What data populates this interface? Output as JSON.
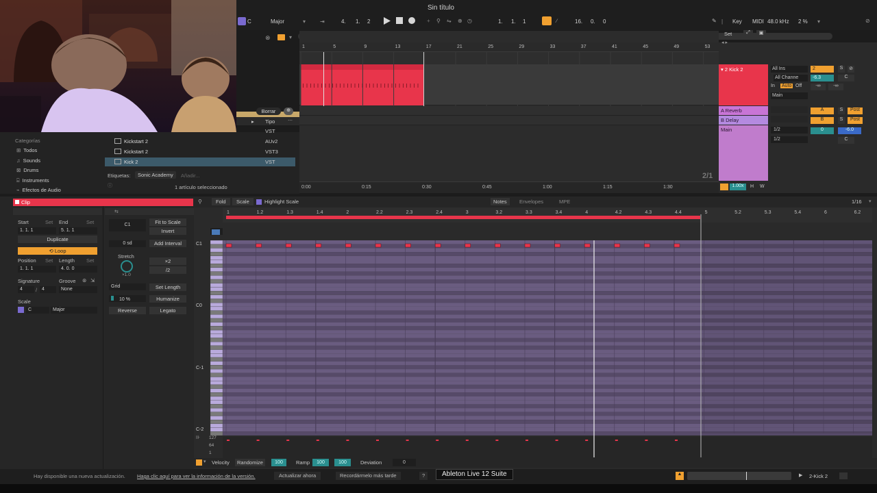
{
  "top": {
    "title": "Sin título",
    "key": "C",
    "scale": "Major",
    "position": [
      "4.",
      "1.",
      "2"
    ],
    "loop_start": [
      "1.",
      "1.",
      "1"
    ],
    "loop_len": [
      "16.",
      "0.",
      "0"
    ],
    "key_btn": "Key",
    "midi_btn": "MIDI",
    "sample_rate": "48.0 kHz",
    "cpu": "2 %"
  },
  "arrangement": {
    "bars": [
      "1",
      "5",
      "9",
      "13",
      "17",
      "21",
      "25",
      "29",
      "33",
      "37",
      "41",
      "45",
      "49",
      "53"
    ],
    "times": [
      "0:00",
      "0:15",
      "0:30",
      "0:45",
      "1:00",
      "1:15",
      "1:30"
    ],
    "zoom": "2/1",
    "set_label": "Set"
  },
  "browser": {
    "delete_btn": "Borrar",
    "col_type": "Tipo",
    "categories_title": "Categorías",
    "categories": [
      "Todos",
      "Sounds",
      "Drums",
      "Instruments",
      "Efectos de Audio"
    ],
    "items": [
      {
        "name": "Kickstart 2",
        "type": "AUv2"
      },
      {
        "name": "Kickstart 2",
        "type": "VST3"
      },
      {
        "name": "Kick 2",
        "type": "VST"
      }
    ],
    "first_type": "VST",
    "tags_label": "Etiquetas:",
    "tag": "Sonic Academy",
    "tag_add": "Añadir...",
    "selected_text": "1 artículo seleccionado"
  },
  "mixer": {
    "tracks": [
      {
        "name": "2 Kick 2",
        "color": "#e8354b"
      },
      {
        "name": "A Reverb",
        "color": "#c875d6"
      },
      {
        "name": "B Delay",
        "color": "#b48ae0"
      },
      {
        "name": "Main",
        "color": "#c07ccc"
      }
    ],
    "all_ins": "All Ins",
    "all_channels": "All Channe",
    "in": "In",
    "auto": "Auto",
    "off": "Off",
    "main": "Main",
    "track_num": "2",
    "vol": "-6.3",
    "pan": "C",
    "inf": "-∞",
    "half": "1/2",
    "send_a": "A",
    "send_b": "B",
    "solo": "S",
    "post": "Post",
    "main_vol": "0",
    "main_vol2": "-6.0"
  },
  "clip": {
    "title": "Clip",
    "start_label": "Start",
    "end_label": "End",
    "set": "Set",
    "start_val": "1.  1.  1",
    "end_val": "5.  1.  1",
    "duplicate": "Duplicate",
    "loop": "Loop",
    "position_label": "Position",
    "length_label": "Length",
    "position_val": "1.  1.  1",
    "length_val": "4.  0.  0",
    "signature_label": "Signature",
    "groove_label": "Groove",
    "sig_num": "4",
    "sig_den": "4",
    "groove_val": "None",
    "scale_label": "Scale",
    "scale_key": "C",
    "scale_mode": "Major",
    "note_c1": "C1",
    "fit_to_scale": "Fit to Scale",
    "invert": "Invert",
    "interval": "0 sd",
    "add_interval": "Add Interval",
    "stretch": "Stretch",
    "x2": "×2",
    "d2": "/2",
    "stretch_val": "×1.0",
    "grid": "Grid",
    "set_length": "Set Length",
    "humanize_pct": "10 %",
    "humanize": "Humanize",
    "reverse": "Reverse",
    "legato": "Legato"
  },
  "pianoroll": {
    "fold": "Fold",
    "scale": "Scale",
    "highlight_scale": "Highlight Scale",
    "tabs": [
      "Notes",
      "Envelopes",
      "MPE"
    ],
    "grid": "1/16",
    "ruler": [
      "1",
      "1.2",
      "1.3",
      "1.4",
      "2",
      "2.2",
      "2.3",
      "2.4",
      "3",
      "3.2",
      "3.3",
      "3.4",
      "4",
      "4.2",
      "4.3",
      "4.4",
      "5",
      "5.2",
      "5.3",
      "5.4",
      "6",
      "6.2"
    ],
    "octaves": [
      "C1",
      "C0",
      "C-1",
      "C-2"
    ],
    "vel_labels": [
      "127",
      "64",
      "1"
    ],
    "notes_count": 16,
    "velocity": "Velocity",
    "randomize": "Randomize",
    "rand_val": "100",
    "ramp": "Ramp",
    "ramp_val1": "100",
    "ramp_val2": "100",
    "deviation": "Deviation",
    "dev_val": "0"
  },
  "status": {
    "update_text": "Hay disponible una nueva actualización.",
    "update_link": "Haga clic aquí para ver la información de la versión.",
    "update_now": "Actualizar ahora",
    "remind_later": "Recordármelo más tarde",
    "help": "?",
    "tooltip": "Ableton Live 12 Suite",
    "track_name": "2-Kick 2"
  },
  "colors": {
    "clip_red": "#e8354b",
    "accent_orange": "#f0a030",
    "teal": "#2a8f8f",
    "purple": "#a086c8"
  }
}
